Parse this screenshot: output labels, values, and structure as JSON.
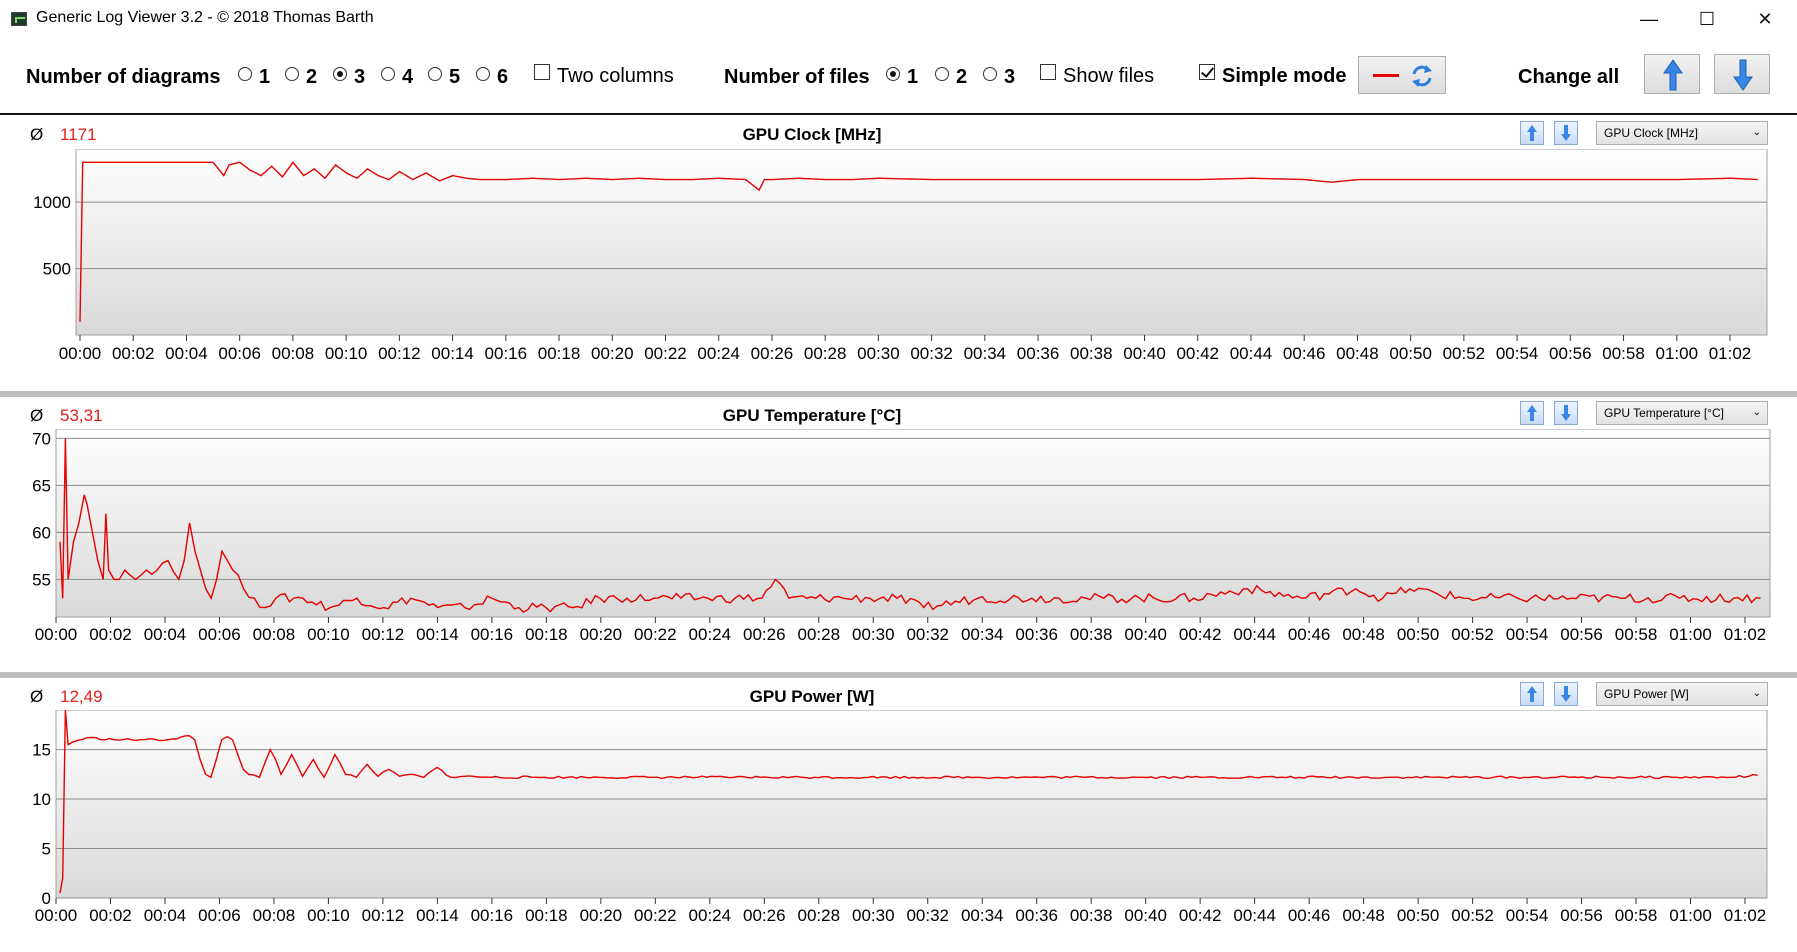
{
  "window": {
    "title": "Generic Log Viewer 3.2 - © 2018 Thomas Barth",
    "minimize": "—",
    "maximize": "☐",
    "close": "✕"
  },
  "toolbar": {
    "num_diagrams_label": "Number of diagrams",
    "diagram_options": [
      "1",
      "2",
      "3",
      "4",
      "5",
      "6"
    ],
    "diagram_selected": "3",
    "two_columns_label": "Two columns",
    "two_columns_checked": false,
    "num_files_label": "Number of files",
    "file_options": [
      "1",
      "2",
      "3"
    ],
    "file_selected": "1",
    "show_files_label": "Show files",
    "show_files_checked": false,
    "simple_mode_label": "Simple mode",
    "simple_mode_checked": true,
    "change_all_label": "Change all",
    "line_color": "#e60000",
    "accent_blue": "#2f7fe0"
  },
  "panels": [
    {
      "avg_symbol": "Ø",
      "avg_value": "1171",
      "title": "GPU Clock [MHz]",
      "selector": "GPU Clock [MHz]"
    },
    {
      "avg_symbol": "Ø",
      "avg_value": "53,31",
      "title": "GPU Temperature [°C]",
      "selector": "GPU Temperature [°C]"
    },
    {
      "avg_symbol": "Ø",
      "avg_value": "12,49",
      "title": "GPU Power [W]",
      "selector": "GPU Power [W]"
    }
  ],
  "chart_data": [
    {
      "type": "line",
      "title": "GPU Clock [MHz]",
      "ylim": [
        0,
        1400
      ],
      "yticks": [
        "500",
        "1000"
      ],
      "xticks": [
        "00:00",
        "00:02",
        "00:04",
        "00:06",
        "00:08",
        "00:10",
        "00:12",
        "00:14",
        "00:16",
        "00:18",
        "00:20",
        "00:22",
        "00:24",
        "00:26",
        "00:28",
        "00:30",
        "00:32",
        "00:34",
        "00:36",
        "00:38",
        "00:40",
        "00:42",
        "00:44",
        "00:46",
        "00:48",
        "00:50",
        "00:52",
        "00:54",
        "00:56",
        "00:58",
        "01:00",
        "01:02"
      ],
      "grid": true,
      "series": [
        {
          "x": [
            0,
            0.1,
            0.3,
            1,
            2,
            3,
            4,
            5,
            5.2,
            5.4,
            5.6,
            6,
            6.4,
            6.8,
            7.2,
            7.6,
            8,
            8.4,
            8.8,
            9.2,
            9.6,
            10,
            10.4,
            10.8,
            11.2,
            11.6,
            12,
            12.5,
            13,
            13.5,
            14,
            14.5,
            15,
            16,
            17,
            18,
            19,
            20,
            21,
            22,
            23,
            24,
            25,
            25.5,
            25.7,
            26,
            27,
            28,
            29,
            30,
            32,
            34,
            36,
            38,
            40,
            42,
            44,
            46,
            47,
            48,
            50,
            52,
            54,
            56,
            58,
            60,
            62,
            63
          ],
          "values": [
            100,
            1300,
            1300,
            1300,
            1300,
            1300,
            1300,
            1300,
            1250,
            1200,
            1280,
            1300,
            1240,
            1200,
            1270,
            1190,
            1300,
            1200,
            1250,
            1180,
            1280,
            1220,
            1180,
            1250,
            1200,
            1170,
            1230,
            1170,
            1220,
            1160,
            1200,
            1180,
            1170,
            1170,
            1180,
            1170,
            1180,
            1170,
            1180,
            1170,
            1170,
            1180,
            1170,
            1090,
            1170,
            1170,
            1180,
            1170,
            1170,
            1180,
            1170,
            1170,
            1170,
            1170,
            1170,
            1170,
            1180,
            1170,
            1150,
            1170,
            1170,
            1170,
            1170,
            1170,
            1170,
            1170,
            1180,
            1170
          ]
        }
      ]
    },
    {
      "type": "line",
      "title": "GPU Temperature [°C]",
      "ylim": [
        51,
        71
      ],
      "yticks": [
        "55",
        "60",
        "65",
        "70"
      ],
      "xticks": [
        "00:00",
        "00:02",
        "00:04",
        "00:06",
        "00:08",
        "00:10",
        "00:12",
        "00:14",
        "00:16",
        "00:18",
        "00:20",
        "00:22",
        "00:24",
        "00:26",
        "00:28",
        "00:30",
        "00:32",
        "00:34",
        "00:36",
        "00:38",
        "00:40",
        "00:42",
        "00:44",
        "00:46",
        "00:48",
        "00:50",
        "00:52",
        "00:54",
        "00:56",
        "00:58",
        "01:00",
        "01:02"
      ],
      "grid": true,
      "series": [
        {
          "x": [
            0,
            0.1,
            0.2,
            0.3,
            0.5,
            0.7,
            0.9,
            1,
            1.2,
            1.4,
            1.6,
            1.7,
            1.8,
            2,
            2.4,
            2.8,
            3.2,
            3.6,
            4,
            4.4,
            4.6,
            4.8,
            5,
            5.2,
            5.4,
            5.6,
            5.8,
            6,
            6.2,
            6.4,
            6.8,
            7.2,
            7.6,
            8,
            9,
            10,
            11,
            12,
            13,
            14,
            15,
            16,
            17,
            18,
            19,
            20,
            21,
            22,
            23,
            24,
            25,
            26,
            26.5,
            27,
            28,
            29,
            30,
            31,
            32,
            34,
            36,
            38,
            40,
            42,
            44,
            46,
            48,
            49,
            50,
            52,
            54,
            56,
            58,
            60,
            62,
            63
          ],
          "values": [
            59,
            53,
            70,
            55,
            59,
            61,
            64,
            63,
            60,
            57,
            55,
            62,
            56,
            55,
            56,
            55,
            56,
            56,
            57,
            55,
            57,
            61,
            58,
            56,
            54,
            53,
            55,
            58,
            57,
            56,
            54,
            53,
            52,
            53,
            53,
            52,
            53,
            52,
            53,
            52,
            52,
            53,
            52,
            52,
            52,
            53,
            53,
            53,
            53,
            53,
            53,
            53,
            55,
            53,
            53,
            53,
            53,
            53,
            52,
            53,
            53,
            53,
            53,
            53,
            54,
            53,
            54,
            53,
            54,
            53,
            53,
            53,
            53,
            53,
            53,
            53
          ]
        }
      ]
    },
    {
      "type": "line",
      "title": "GPU Power [W]",
      "ylim": [
        0,
        19
      ],
      "yticks": [
        "0",
        "5",
        "10",
        "15"
      ],
      "xticks": [
        "00:00",
        "00:02",
        "00:04",
        "00:06",
        "00:08",
        "00:10",
        "00:12",
        "00:14",
        "00:16",
        "00:18",
        "00:20",
        "00:22",
        "00:24",
        "00:26",
        "00:28",
        "00:30",
        "00:32",
        "00:34",
        "00:36",
        "00:38",
        "00:40",
        "00:42",
        "00:44",
        "00:46",
        "00:48",
        "00:50",
        "00:52",
        "00:54",
        "00:56",
        "00:58",
        "01:00",
        "01:02"
      ],
      "grid": true,
      "series": [
        {
          "x": [
            0,
            0.1,
            0.2,
            0.3,
            0.5,
            1,
            2,
            3,
            4,
            4.8,
            5,
            5.2,
            5.4,
            5.6,
            5.8,
            6,
            6.2,
            6.4,
            6.6,
            6.8,
            7,
            7.4,
            7.8,
            8,
            8.2,
            8.6,
            9,
            9.4,
            9.8,
            10.2,
            10.6,
            11,
            11.4,
            11.8,
            12.2,
            12.6,
            13,
            13.5,
            14,
            14.5,
            15,
            16,
            18,
            20,
            22,
            24,
            25,
            26,
            28,
            30,
            32,
            34,
            36,
            38,
            40,
            42,
            44,
            46,
            48,
            50,
            52,
            54,
            56,
            58,
            60,
            62,
            63
          ],
          "values": [
            0.5,
            2,
            19,
            15.5,
            15.8,
            16.2,
            16,
            16,
            16,
            16.4,
            16,
            14,
            12.5,
            12.2,
            14,
            16,
            16.3,
            16,
            14.5,
            13,
            12.5,
            12.2,
            15,
            14,
            12.5,
            14.5,
            12.3,
            14,
            12.2,
            14.5,
            12.5,
            12.2,
            13.5,
            12.3,
            13,
            12.3,
            12.5,
            12.2,
            13.2,
            12.2,
            12.3,
            12.2,
            12.2,
            12.2,
            12.2,
            12.2,
            12.2,
            12.2,
            12.2,
            12.2,
            12.2,
            12.2,
            12.2,
            12.2,
            12.2,
            12.2,
            12.2,
            12.2,
            12.2,
            12.2,
            12.2,
            12.2,
            12.2,
            12.2,
            12.2,
            12.2,
            12.4
          ]
        }
      ]
    }
  ]
}
